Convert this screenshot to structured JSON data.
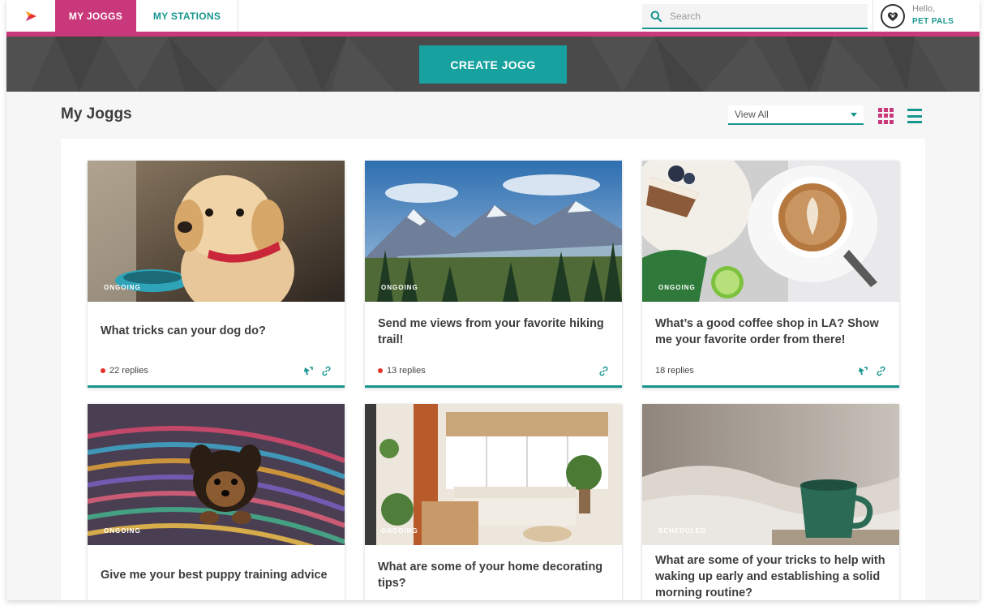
{
  "nav": {
    "tabs": [
      {
        "label": "MY JOGGS",
        "active": true
      },
      {
        "label": "MY STATIONS",
        "active": false
      }
    ],
    "search_placeholder": "Search",
    "user_greeting": "Hello,",
    "user_name": "PET PALS"
  },
  "hero": {
    "create_label": "CREATE JOGG"
  },
  "main": {
    "title": "My Joggs",
    "filter_value": "View All"
  },
  "cards": [
    {
      "status": "ONGOING",
      "title": "What tricks can your dog do?",
      "replies": "22 replies",
      "unread": true,
      "icons": [
        "station-icon",
        "link-icon"
      ]
    },
    {
      "status": "ONGOING",
      "title": "Send me views from your favorite hiking trail!",
      "replies": "13 replies",
      "unread": true,
      "icons": [
        "link-icon"
      ]
    },
    {
      "status": "ONGOING",
      "title": "What’s a good coffee shop in LA? Show me your favorite order from there!",
      "replies": "18 replies",
      "unread": false,
      "icons": [
        "station-icon",
        "link-icon"
      ]
    },
    {
      "status": "ONGOING",
      "title": "Give me your best puppy training advice"
    },
    {
      "status": "ONGOING",
      "title": "What are some of your home decorating tips?"
    },
    {
      "status": "SCHEDULED",
      "title": "What are some of your tricks to help with waking up early and establishing a solid morning routine?"
    }
  ],
  "colors": {
    "brand_pink": "#c9387a",
    "brand_teal": "#17968f",
    "button_teal": "#17a2a0",
    "unread_dot": "#e5332a"
  }
}
